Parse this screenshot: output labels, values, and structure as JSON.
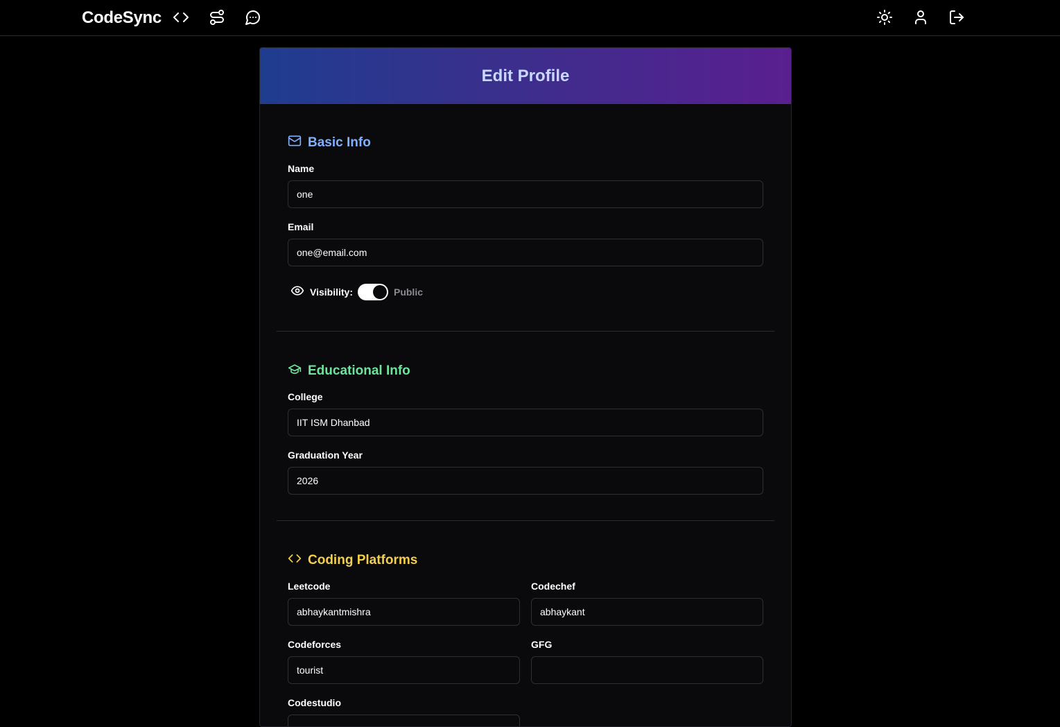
{
  "navbar": {
    "brand": "CodeSync",
    "left_icons": [
      "code-icon",
      "route-icon",
      "chat-icon"
    ],
    "right_icons": [
      "sun-icon",
      "user-icon",
      "logout-icon"
    ]
  },
  "card": {
    "title": "Edit Profile"
  },
  "basic_info": {
    "title": "Basic Info",
    "icon": "mail-icon",
    "name_label": "Name",
    "name_value": "one",
    "email_label": "Email",
    "email_value": "one@email.com",
    "visibility_label": "Visibility:",
    "visibility_state": "Public",
    "visibility_on": true
  },
  "educational_info": {
    "title": "Educational Info",
    "icon": "graduation-cap-icon",
    "college_label": "College",
    "college_value": "IIT ISM Dhanbad",
    "grad_label": "Graduation Year",
    "grad_value": "2026"
  },
  "coding_platforms": {
    "title": "Coding Platforms",
    "icon": "code-icon",
    "leetcode_label": "Leetcode",
    "leetcode_value": "abhaykantmishra",
    "codechef_label": "Codechef",
    "codechef_value": "abhaykant",
    "codeforces_label": "Codeforces",
    "codeforces_value": "tourist",
    "gfg_label": "GFG",
    "gfg_value": "",
    "codestudio_label": "Codestudio",
    "codestudio_value": ""
  },
  "colors": {
    "background": "#000000",
    "card": "#0a0a0d",
    "header_gradient_start": "#1f3d8f",
    "header_gradient_end": "#5a1f8f",
    "basic_info_accent": "#7fb0ff",
    "educational_accent": "#6fe39a",
    "coding_accent": "#f3cf4a"
  }
}
